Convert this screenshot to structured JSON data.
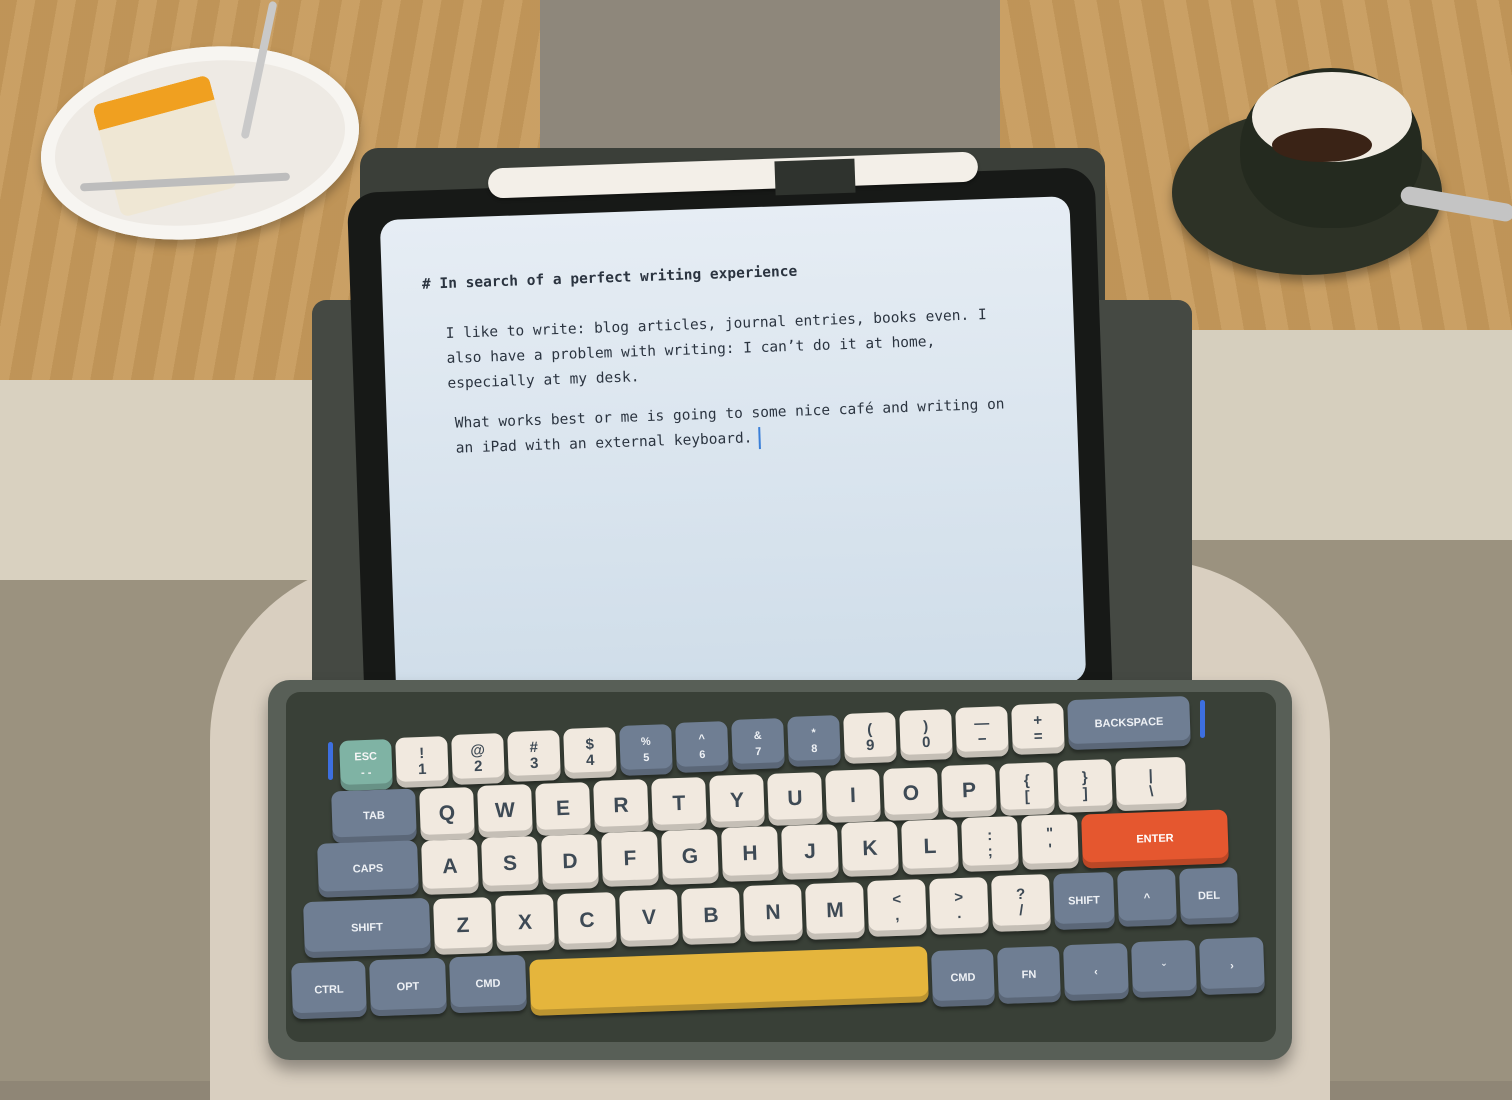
{
  "document": {
    "heading": "# In search of a perfect writing experience",
    "paragraph_1": [
      "I like to write: blog articles, journal entries, books even. I",
      "also have a problem with writing: I can’t do it at home,",
      "especially at my desk."
    ],
    "paragraph_2": [
      "What works best or me is going to some nice café and writing on",
      "an iPad with an external keyboard."
    ]
  },
  "keyboard": {
    "row1": [
      "ESC",
      "!",
      "@",
      "#",
      "$",
      "%",
      "^",
      "&",
      "*",
      "(",
      ")",
      "—",
      "+",
      "BACKSPACE"
    ],
    "row1_sub": [
      "- -",
      "1",
      "2",
      "3",
      "4",
      "5",
      "6",
      "7",
      "8",
      "9",
      "0",
      "−",
      "=",
      ""
    ],
    "row2": [
      "TAB",
      "Q",
      "W",
      "E",
      "R",
      "T",
      "Y",
      "U",
      "I",
      "O",
      "P",
      "{",
      "}",
      "|"
    ],
    "row2_sub": [
      "",
      "",
      "",
      "",
      "",
      "",
      "",
      "",
      "",
      "",
      "",
      "[",
      "]",
      "\\"
    ],
    "row3": [
      "CAPS",
      "A",
      "S",
      "D",
      "F",
      "G",
      "H",
      "J",
      "K",
      "L",
      ":",
      "\"",
      "ENTER"
    ],
    "row3_sub": [
      "",
      "",
      "",
      "",
      "",
      "",
      "",
      "",
      "",
      "",
      ";",
      "'",
      ""
    ],
    "row4": [
      "SHIFT",
      "Z",
      "X",
      "C",
      "V",
      "B",
      "N",
      "M",
      "<",
      ">",
      "?",
      "SHIFT",
      "^",
      "DEL"
    ],
    "row4_sub": [
      "",
      "",
      "",
      "",
      "",
      "",
      "",
      "",
      ",",
      ".",
      "/",
      "",
      "",
      ""
    ],
    "row5": [
      "CTRL",
      "OPT",
      "CMD",
      "",
      "CMD",
      "FN",
      "‹",
      "ˇ",
      "›"
    ]
  }
}
